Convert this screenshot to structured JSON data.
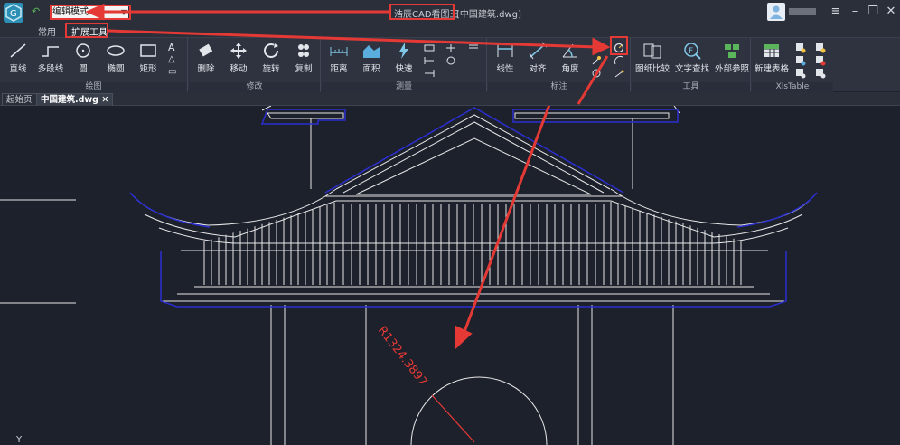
{
  "titlebar": {
    "mode_value": "编辑模式",
    "app_name": "浩辰CAD看图王",
    "file_name": "[中国建筑.dwg]"
  },
  "tabs": [
    {
      "label": "常用"
    },
    {
      "label": "扩展工具"
    }
  ],
  "ribbon": {
    "groups": [
      {
        "label": "绘图",
        "tools": [
          "直线",
          "多段线",
          "圆",
          "椭圆",
          "矩形"
        ]
      },
      {
        "label": "修改",
        "tools": [
          "删除",
          "移动",
          "旋转",
          "复制"
        ]
      },
      {
        "label": "测量",
        "tools": [
          "距离",
          "面积",
          "快速"
        ]
      },
      {
        "label": "标注",
        "tools": [
          "线性",
          "对齐",
          "角度"
        ]
      },
      {
        "label": "工具",
        "tools": [
          "图纸比较",
          "文字查找",
          "外部参照"
        ]
      },
      {
        "label": "XlsTable",
        "tools": [
          "新建表格"
        ]
      }
    ]
  },
  "doctabs": [
    {
      "label": "起始页"
    },
    {
      "label": "中国建筑.dwg"
    }
  ],
  "drawing": {
    "dimension_text": "R1324.3897"
  },
  "colors": {
    "highlight": "#e53935",
    "canvas_bg": "#1d212c",
    "blue_outline": "#2b2fd0"
  }
}
